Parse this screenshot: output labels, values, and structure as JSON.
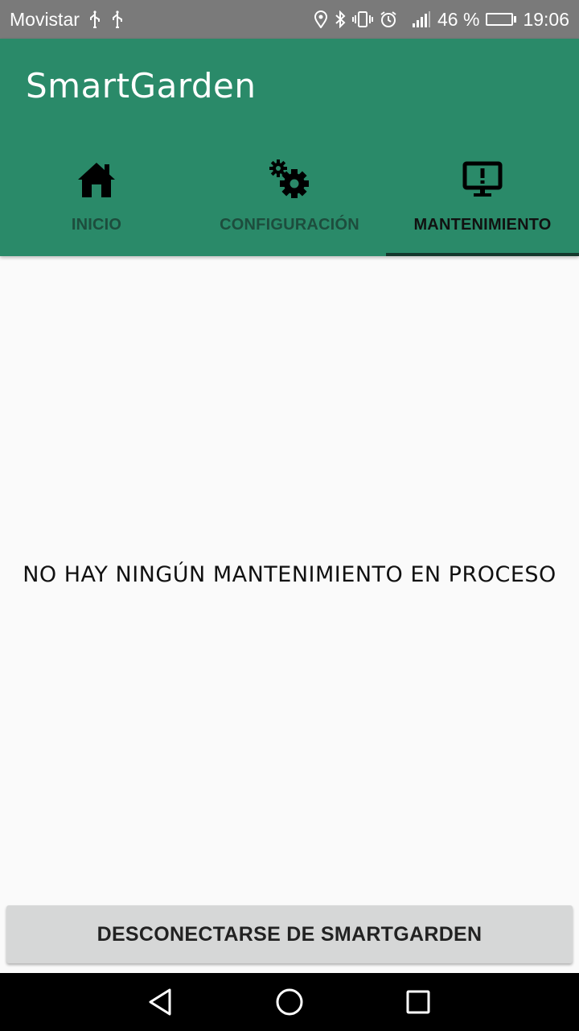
{
  "status_bar": {
    "carrier": "Movistar",
    "battery_percent": "46 %",
    "battery_level": 0.46,
    "time": "19:06",
    "icons": [
      "usb-icon",
      "usb-icon",
      "location-icon",
      "bluetooth-icon",
      "vibrate-icon",
      "alarm-icon",
      "signal-icon",
      "battery-icon"
    ]
  },
  "app_bar": {
    "title": "SmartGarden",
    "color": "#2a8a69"
  },
  "tabs": [
    {
      "label": "INICIO",
      "icon": "home-icon"
    },
    {
      "label": "CONFIGURACIÓN",
      "icon": "gears-icon"
    },
    {
      "label": "MANTENIMIENTO",
      "icon": "monitor-alert-icon",
      "active": true
    }
  ],
  "content": {
    "empty_message": "NO HAY NINGÚN MANTENIMIENTO EN PROCESO"
  },
  "footer": {
    "disconnect_label": "DESCONECTARSE DE SMARTGARDEN"
  },
  "nav_bar": {
    "buttons": [
      "back-icon",
      "home-circle-icon",
      "recents-icon"
    ]
  }
}
